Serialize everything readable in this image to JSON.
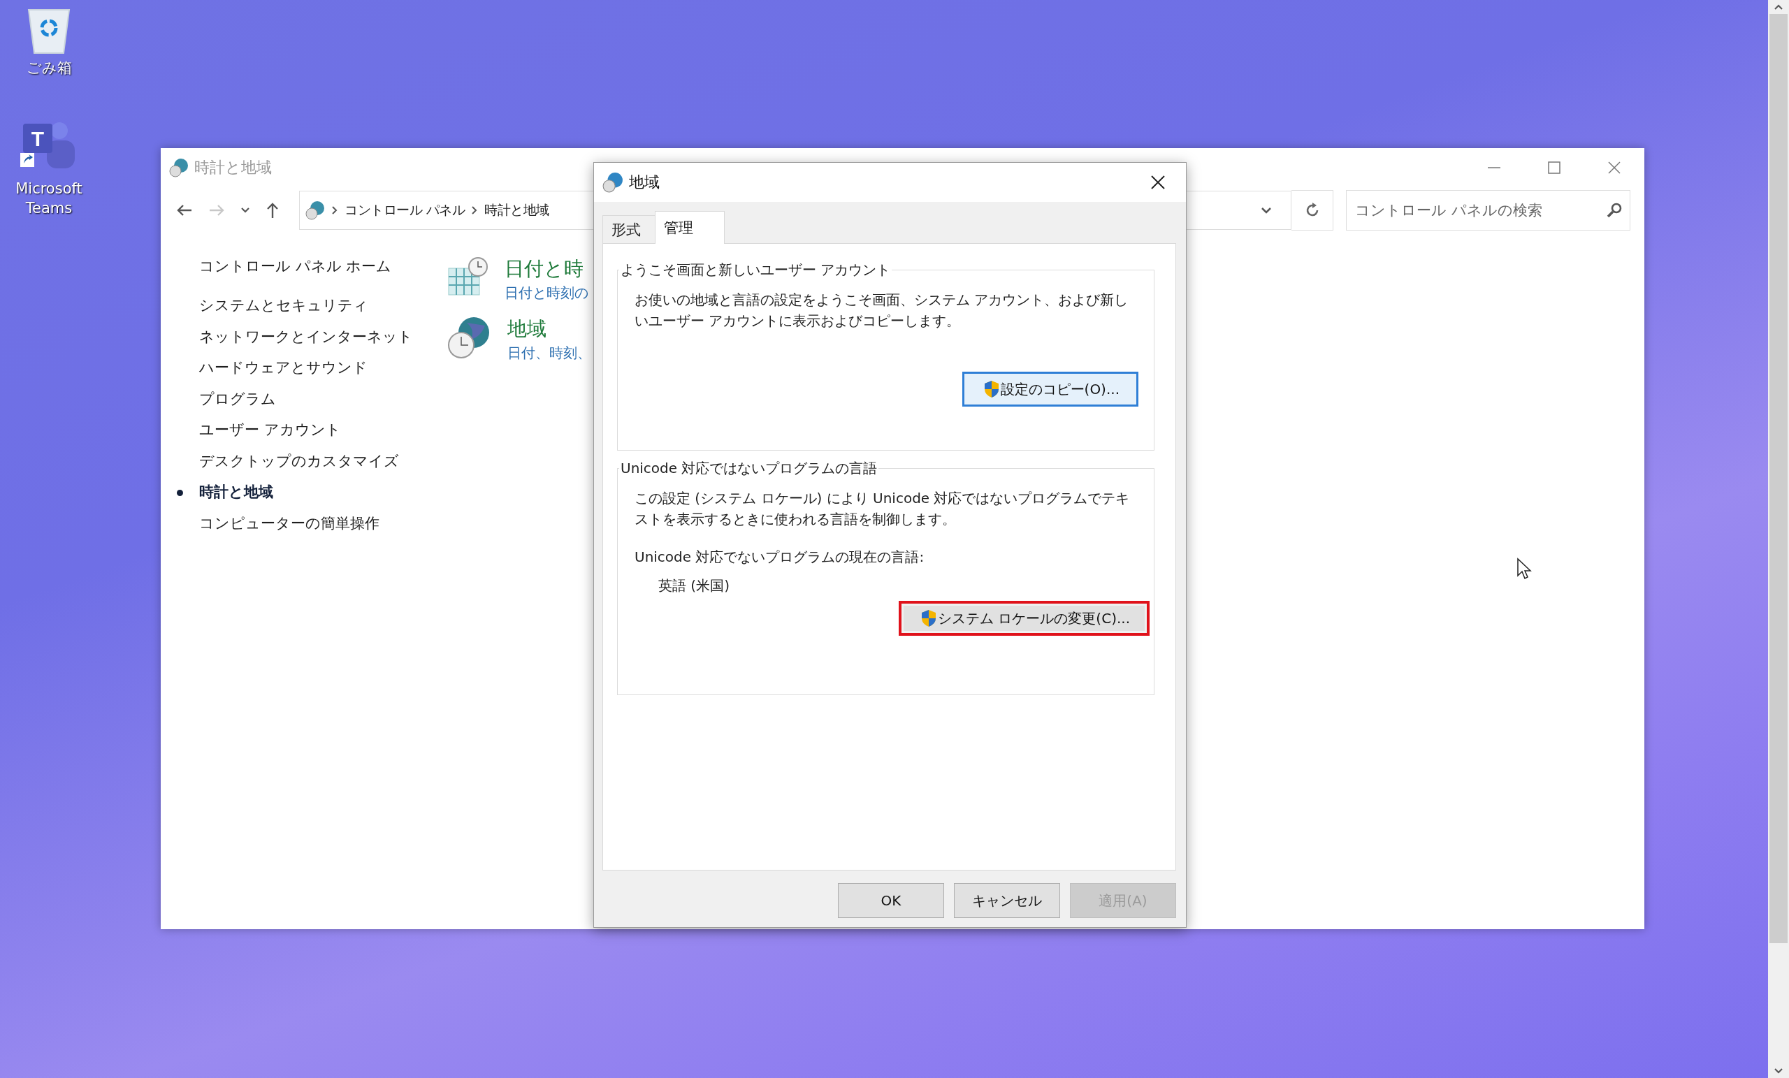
{
  "desktop": {
    "icons": [
      {
        "label": "ごみ箱",
        "kind": "recycle-bin"
      },
      {
        "label": "Microsoft Teams",
        "kind": "teams",
        "logo_letter": "T"
      }
    ]
  },
  "window": {
    "title": "時計と地域",
    "nav_buttons": [
      {
        "kind": "back",
        "disabled": false
      },
      {
        "kind": "forward",
        "disabled": true
      },
      {
        "kind": "recent",
        "disabled": false
      },
      {
        "kind": "up",
        "disabled": false
      }
    ],
    "breadcrumb": [
      "コントロール パネル",
      "時計と地域"
    ],
    "search": {
      "placeholder": "コントロール パネルの検索"
    },
    "sidebar": {
      "home": "コントロール パネル ホーム",
      "items": [
        {
          "label": "システムとセキュリティ",
          "selected": false
        },
        {
          "label": "ネットワークとインターネット",
          "selected": false
        },
        {
          "label": "ハードウェアとサウンド",
          "selected": false
        },
        {
          "label": "プログラム",
          "selected": false
        },
        {
          "label": "ユーザー アカウント",
          "selected": false
        },
        {
          "label": "デスクトップのカスタマイズ",
          "selected": false
        },
        {
          "label": "時計と地域",
          "selected": true
        },
        {
          "label": "コンピューターの簡単操作",
          "selected": false
        }
      ]
    },
    "categories": [
      {
        "kind": "calendar",
        "title": "日付と時",
        "subtitle": "日付と時刻の"
      },
      {
        "kind": "globe",
        "title": "地域",
        "subtitle": "日付、時刻、"
      }
    ]
  },
  "dialog": {
    "title": "地域",
    "tabs": [
      {
        "label": "形式",
        "selected": false
      },
      {
        "label": "管理",
        "selected": true
      }
    ],
    "groups": [
      {
        "label": "ようこそ画面と新しいユーザー アカウント",
        "description": "お使いの地域と言語の設定をようこそ画面、システム アカウント、および新しいユーザー アカウントに表示およびコピーします。",
        "button": {
          "label": "設定のコピー(O)...",
          "focused": true,
          "highlighted": false
        }
      },
      {
        "label": "Unicode 対応ではないプログラムの言語",
        "description": "この設定 (システム ロケール) により Unicode 対応ではないプログラムでテキストを表示するときに使われる言語を制御します。",
        "current_label": "Unicode 対応でないプログラムの現在の言語:",
        "current_value": "英語 (米国)",
        "button": {
          "label": "システム ロケールの変更(C)...",
          "focused": false,
          "highlighted": true
        }
      }
    ],
    "buttons": [
      {
        "label": "OK",
        "disabled": false
      },
      {
        "label": "キャンセル",
        "disabled": false
      },
      {
        "label": "適用(A)",
        "disabled": true
      }
    ]
  }
}
